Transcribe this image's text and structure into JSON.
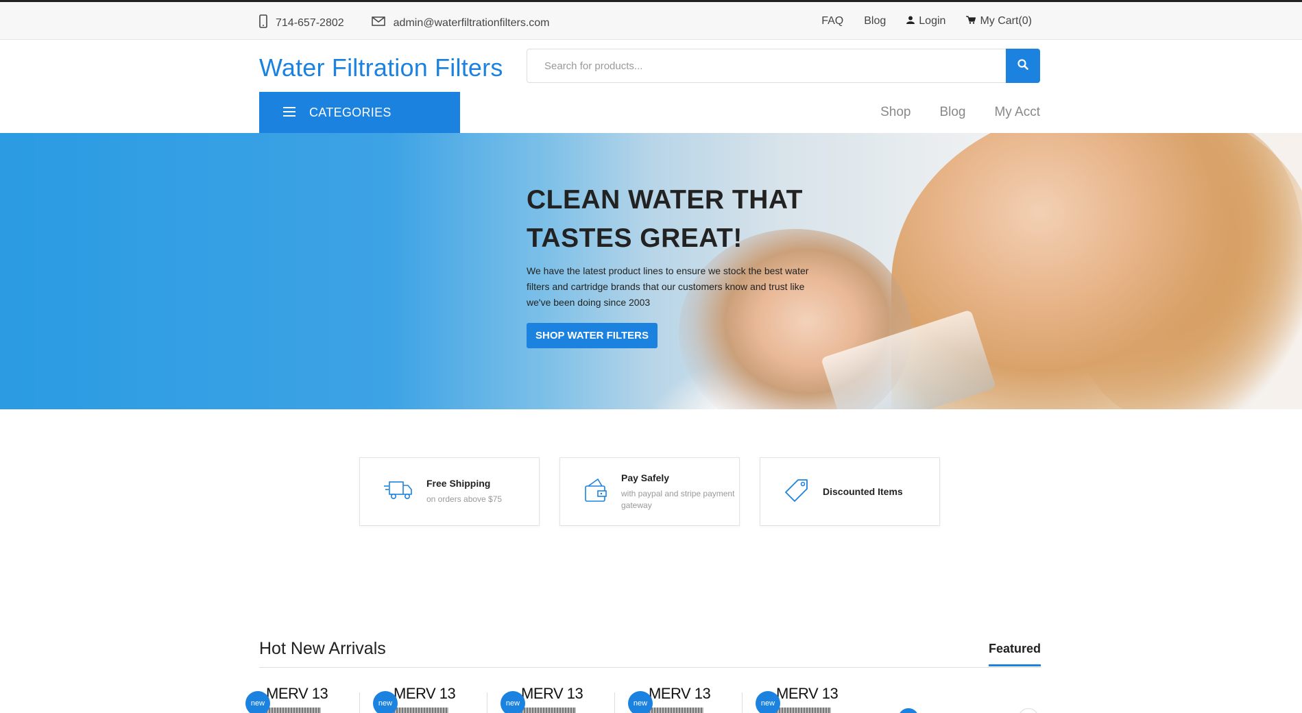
{
  "topbar": {
    "phone": "714-657-2802",
    "email": "admin@waterfiltrationfilters.com",
    "faq": "FAQ",
    "blog": "Blog",
    "login": "Login",
    "cart": "My Cart(0)"
  },
  "header": {
    "logo": "Water Filtration Filters",
    "search_placeholder": "Search for products..."
  },
  "nav": {
    "categories": "CATEGORIES",
    "links": [
      "Shop",
      "Blog",
      "My Acct"
    ]
  },
  "hero": {
    "title_line1": "CLEAN WATER THAT",
    "title_line2": "TASTES GREAT!",
    "text": "We have the latest product lines to ensure we stock the best water filters and cartridge brands that our customers know and trust like we've been doing since 2003",
    "button": "SHOP WATER FILTERS"
  },
  "features": [
    {
      "title": "Free Shipping",
      "subtitle": "on orders above $75",
      "icon": "truck-icon"
    },
    {
      "title": "Pay Safely",
      "subtitle": "with paypal and stripe payment gateway",
      "icon": "wallet-icon"
    },
    {
      "title": "Discounted Items",
      "subtitle": "",
      "icon": "tag-icon"
    }
  ],
  "section": {
    "title": "Hot New Arrivals",
    "tab": "Featured"
  },
  "products": [
    {
      "title": "MERV 13",
      "badge": "new"
    },
    {
      "title": "MERV 13",
      "badge": "new"
    },
    {
      "title": "MERV 13",
      "badge": "new"
    },
    {
      "title": "MERV 13",
      "badge": "new"
    },
    {
      "title": "MERV 13",
      "badge": "new"
    }
  ],
  "colors": {
    "accent": "#1b82e0",
    "text": "#222222"
  }
}
